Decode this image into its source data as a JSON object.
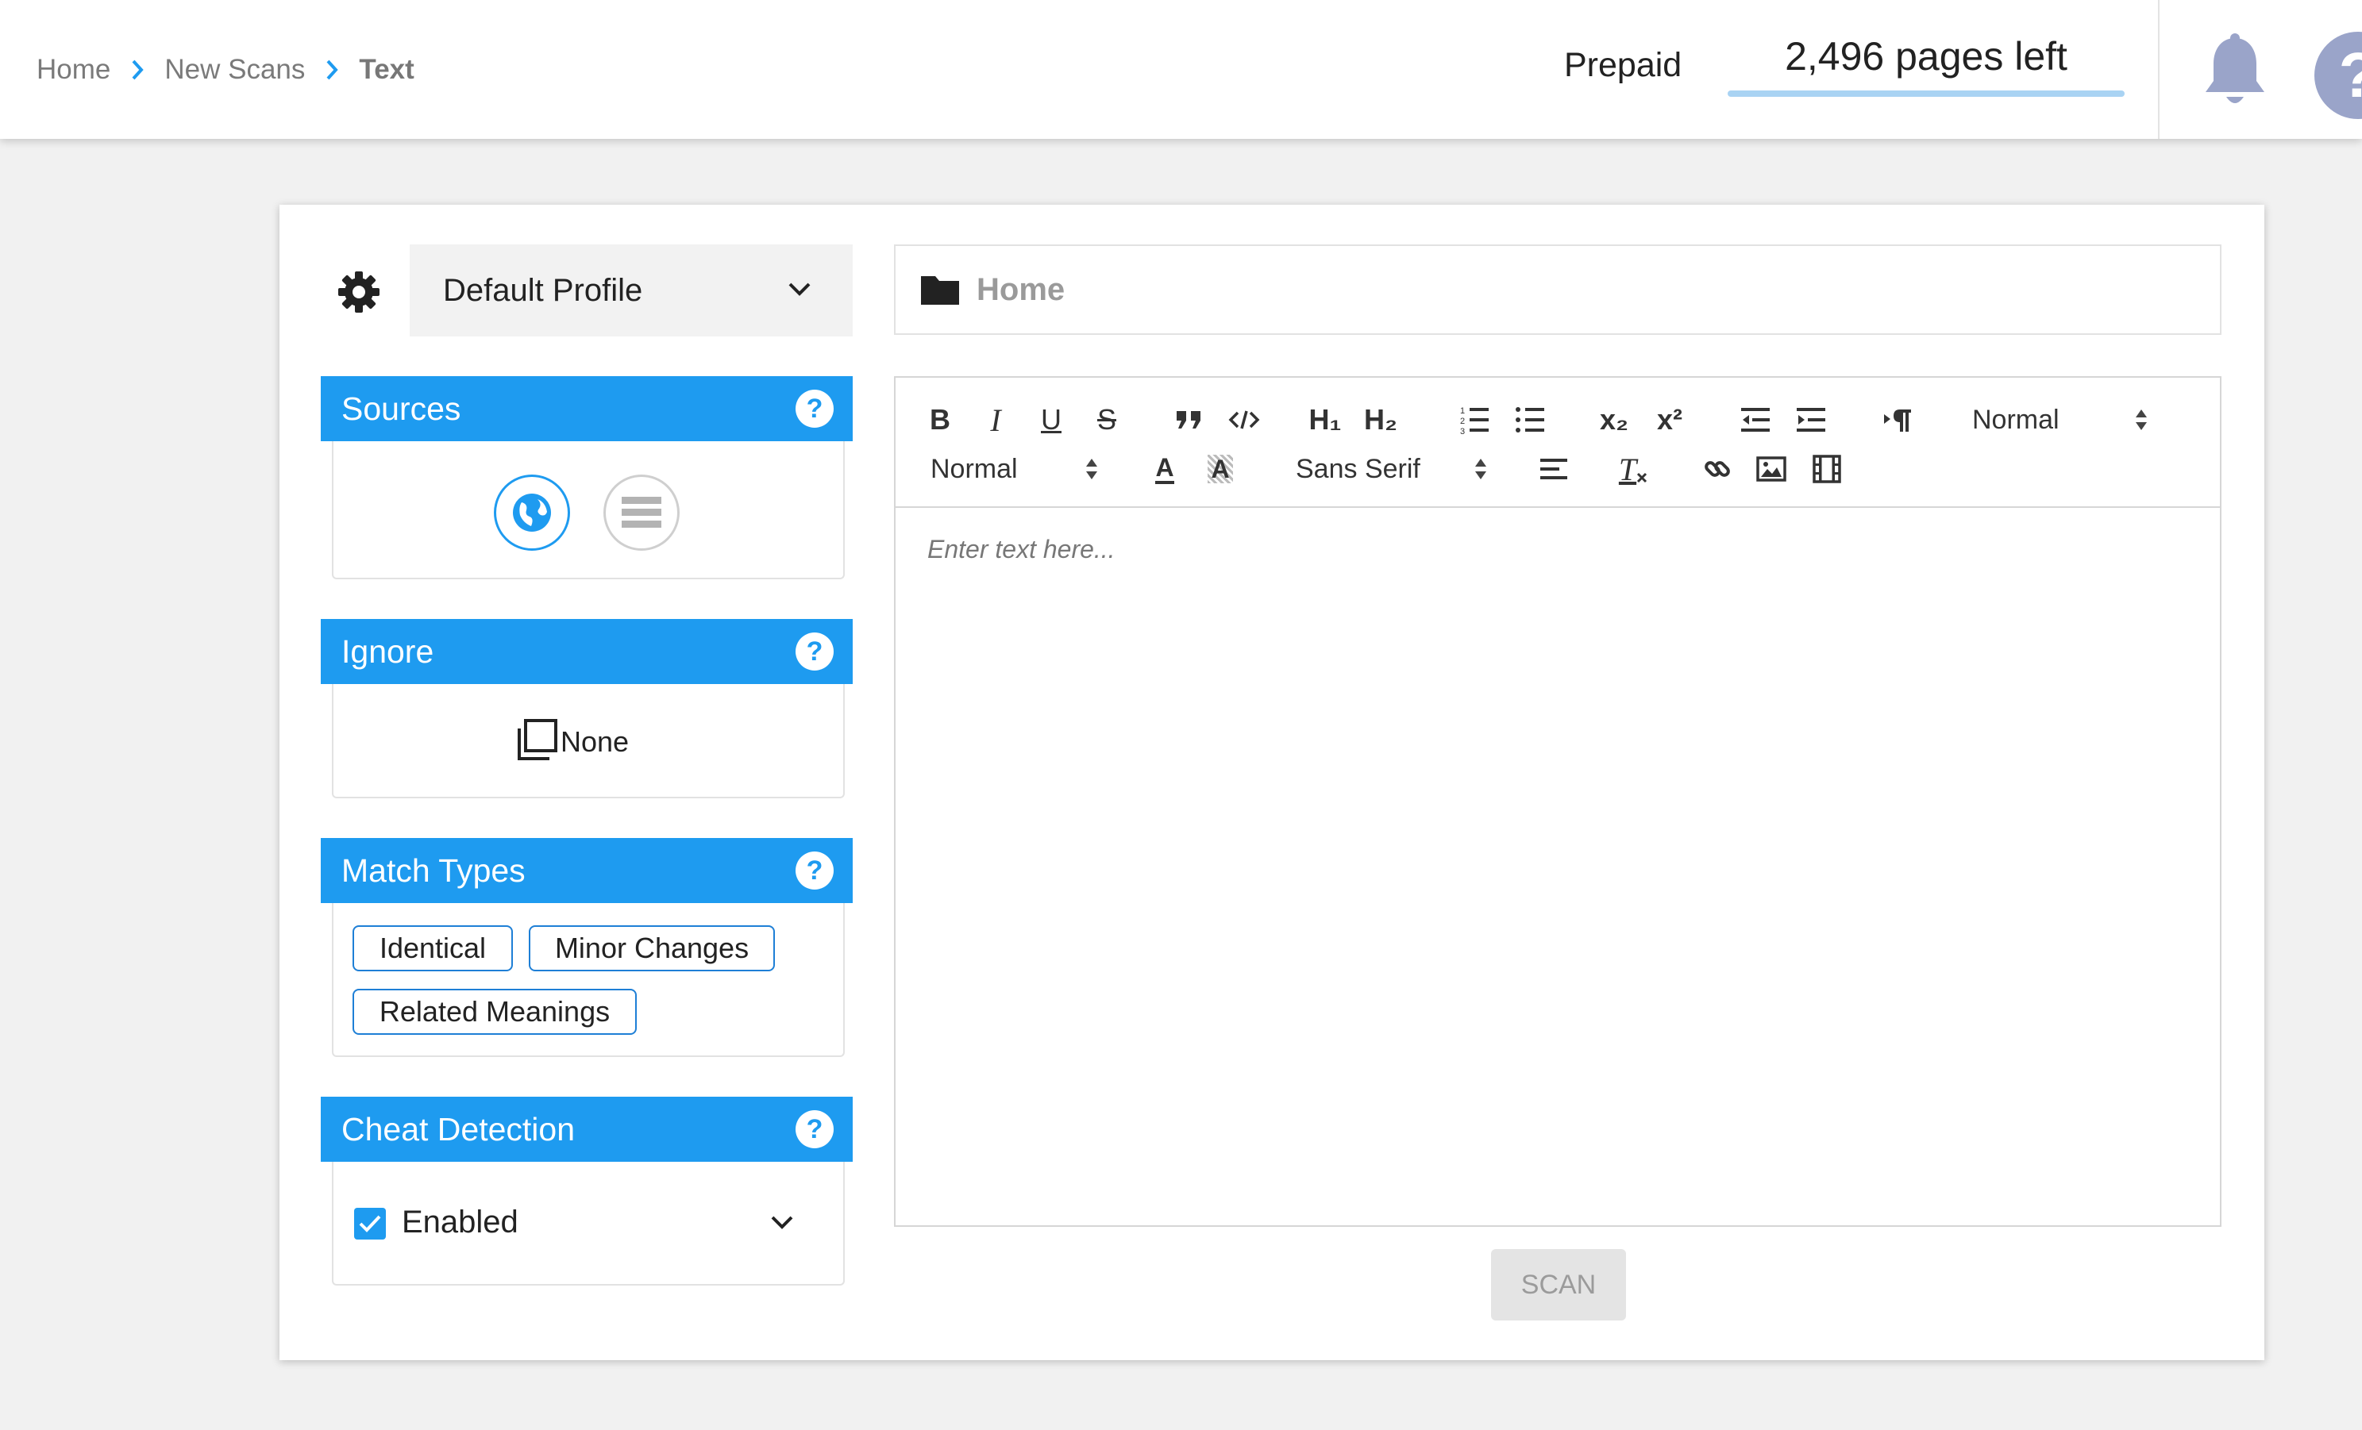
{
  "header": {
    "breadcrumbs": [
      "Home",
      "New Scans",
      "Text"
    ],
    "plan_label": "Prepaid",
    "pages_left": "2,496 pages left",
    "help_glyph": "?"
  },
  "profile": {
    "selected": "Default Profile"
  },
  "sections": {
    "sources": {
      "title": "Sources",
      "help": "?",
      "options": [
        "internet-globe-icon",
        "database-list-icon"
      ]
    },
    "ignore": {
      "title": "Ignore",
      "help": "?",
      "value": "None"
    },
    "match_types": {
      "title": "Match Types",
      "help": "?",
      "tags": [
        "Identical",
        "Minor Changes",
        "Related Meanings"
      ]
    },
    "cheat_detection": {
      "title": "Cheat Detection",
      "help": "?",
      "checkbox_label": "Enabled",
      "checked": true
    }
  },
  "folder": {
    "label": "Home"
  },
  "editor": {
    "toolbar": {
      "bold": "B",
      "italic": "I",
      "underline": "U",
      "strike": "S",
      "h1": "H₁",
      "h2": "H₂",
      "subscript": "x₂",
      "superscript": "x²",
      "header_select": "Normal",
      "size_select": "Normal",
      "font_select": "Sans Serif",
      "color_letter": "A",
      "bg_letter": "A",
      "clear_format": "T"
    },
    "placeholder": "Enter text here..."
  },
  "scan_button": "SCAN",
  "colors": {
    "accent": "#1e9bf0",
    "tag_border": "#1e7fd6",
    "help_avatar": "#9aa4c9",
    "pages_bar": "#a9d3f3"
  }
}
